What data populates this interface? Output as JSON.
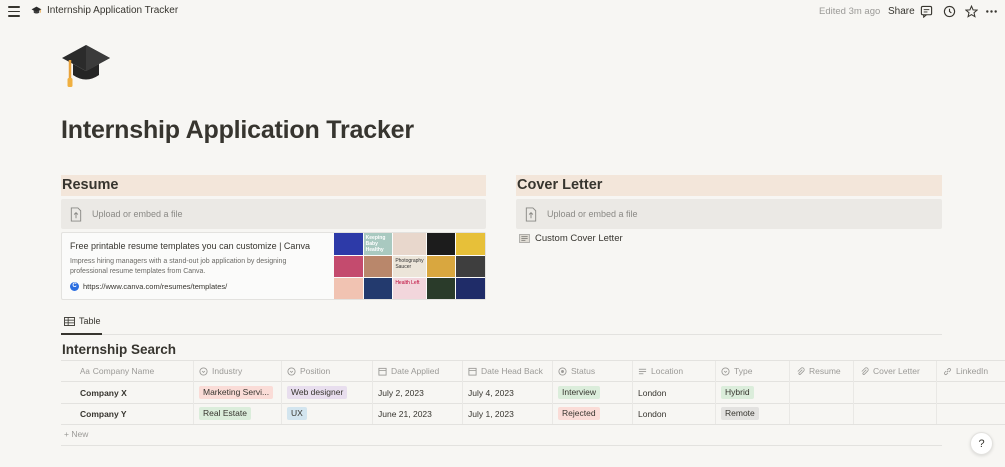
{
  "topbar": {
    "breadcrumb": "Internship Application Tracker",
    "edited": "Edited 3m ago",
    "share": "Share"
  },
  "page": {
    "title": "Internship Application Tracker",
    "icon": "graduation-cap-icon"
  },
  "resume": {
    "heading": "Resume",
    "upload_label": "Upload or embed a file",
    "bookmark": {
      "title": "Free printable resume templates you can customize | Canva",
      "description": "Impress hiring managers with a stand-out job application by designing professional resume templates from Canva.",
      "url": "https://www.canva.com/resumes/templates/",
      "thumbnail_texts": [
        "Keeping Baby Healthy",
        "Photography Saucer",
        "Health Left"
      ]
    }
  },
  "cover_letter": {
    "heading": "Cover Letter",
    "upload_label": "Upload or embed a file",
    "link": "Custom Cover Letter"
  },
  "database": {
    "view_tab": "Table",
    "title": "Internship Search",
    "columns": [
      "Company Name",
      "Industry",
      "Position",
      "Date Applied",
      "Date Head Back",
      "Status",
      "Location",
      "Type",
      "Resume",
      "Cover Letter",
      "LinkedIn"
    ],
    "rows": [
      {
        "company": "Company X",
        "industry": "Marketing Servi...",
        "position": "Web designer",
        "date_applied": "July 2, 2023",
        "date_head_back": "July 4, 2023",
        "status": "Interview",
        "location": "London",
        "type": "Hybrid"
      },
      {
        "company": "Company Y",
        "industry": "Real Estate",
        "position": "UX",
        "date_applied": "June 21, 2023",
        "date_head_back": "July 1, 2023",
        "status": "Rejected",
        "location": "London",
        "type": "Remote"
      }
    ],
    "new_label": "+ New"
  },
  "help_label": "?",
  "colors": {
    "section_header_bg": "#f3e6da",
    "tag_red": "#fadcd7",
    "tag_purple": "#e8deee",
    "tag_blue": "#d3e5ef",
    "tag_green": "#dbeddb",
    "tag_gray": "#e3e2e0"
  }
}
